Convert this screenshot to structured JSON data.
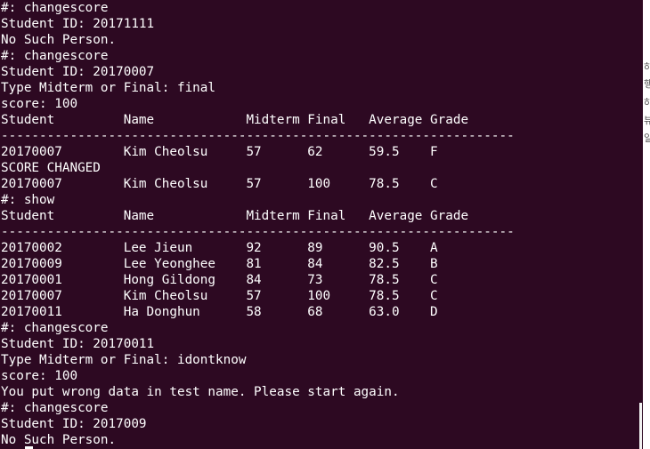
{
  "terminal": {
    "lines": [
      "#: changescore",
      "Student ID: 20171111",
      "No Such Person.",
      "#: changescore",
      "Student ID: 20170007",
      "Type Midterm or Final: final",
      "score: 100",
      "Student         Name            Midterm Final   Average Grade",
      "-------------------------------------------------------------------",
      "20170007        Kim Cheolsu     57      62      59.5    F",
      "SCORE CHANGED",
      "20170007        Kim Cheolsu     57      100     78.5    C",
      "#: show",
      "Student         Name            Midterm Final   Average Grade",
      "-------------------------------------------------------------------",
      "20170002        Lee Jieun       92      89      90.5    A",
      "20170009        Lee Yeonghee    81      84      82.5    B",
      "20170001        Hong Gildong    84      73      78.5    C",
      "20170007        Kim Cheolsu     57      100     78.5    C",
      "20170011        Ha Donghun      58      68      63.0    D",
      "#: changescore",
      "Student ID: 20170011",
      "Type Midterm or Final: idontknow",
      "score: 100",
      "You put wrong data in test name. Please start again.",
      "#: changescore",
      "Student ID: 2017009",
      "No Such Person."
    ]
  },
  "background_window": {
    "partial_glyphs": [
      "하",
      "행",
      "하",
      "뷰",
      "일"
    ]
  },
  "colors": {
    "terminal_bg": "#2d0922",
    "terminal_fg": "#ffffff",
    "background_window": "#ffffff"
  }
}
